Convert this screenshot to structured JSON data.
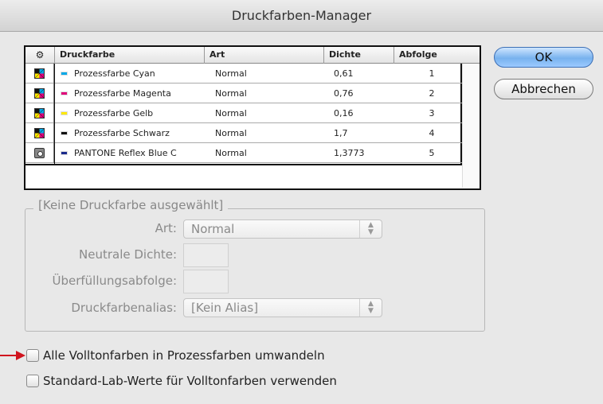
{
  "window": {
    "title": "Druckfarben-Manager"
  },
  "table": {
    "headers": [
      "",
      "Druckfarbe",
      "Art",
      "Dichte",
      "Abfolge"
    ],
    "rows": [
      {
        "icon": "process-ink-icon",
        "swatch": "#00a8e8",
        "name": "Prozessfarbe Cyan",
        "art": "Normal",
        "dichte": "0,61",
        "abfolge": "1"
      },
      {
        "icon": "process-ink-icon",
        "swatch": "#e0007a",
        "name": "Prozessfarbe Magenta",
        "art": "Normal",
        "dichte": "0,76",
        "abfolge": "2"
      },
      {
        "icon": "process-ink-icon",
        "swatch": "#ffe800",
        "name": "Prozessfarbe Gelb",
        "art": "Normal",
        "dichte": "0,16",
        "abfolge": "3"
      },
      {
        "icon": "process-ink-icon",
        "swatch": "#111111",
        "name": "Prozessfarbe Schwarz",
        "art": "Normal",
        "dichte": "1,7",
        "abfolge": "4"
      },
      {
        "icon": "spot-ink-icon",
        "swatch": "#1a2a8c",
        "name": "PANTONE Reflex Blue C",
        "art": "Normal",
        "dichte": "1,3773",
        "abfolge": "5"
      }
    ]
  },
  "buttons": {
    "ok": "OK",
    "cancel": "Abbrechen"
  },
  "details": {
    "group_title": "[Keine Druckfarbe ausgewählt]",
    "art_label": "Art:",
    "art_value": "Normal",
    "dichte_label": "Neutrale Dichte:",
    "trap_label": "Überfüllungsabfolge:",
    "alias_label": "Druckfarbenalias:",
    "alias_value": "[Kein Alias]"
  },
  "options": {
    "convert_spot": "Alle Volltonfarben in Prozessfarben umwandeln",
    "use_lab": "Standard-Lab-Werte für Volltonfarben verwenden",
    "convert_spot_checked": false,
    "use_lab_checked": false
  },
  "colors": {
    "accent_button": "#78b2ee",
    "pointer_arrow": "#d0141e"
  }
}
